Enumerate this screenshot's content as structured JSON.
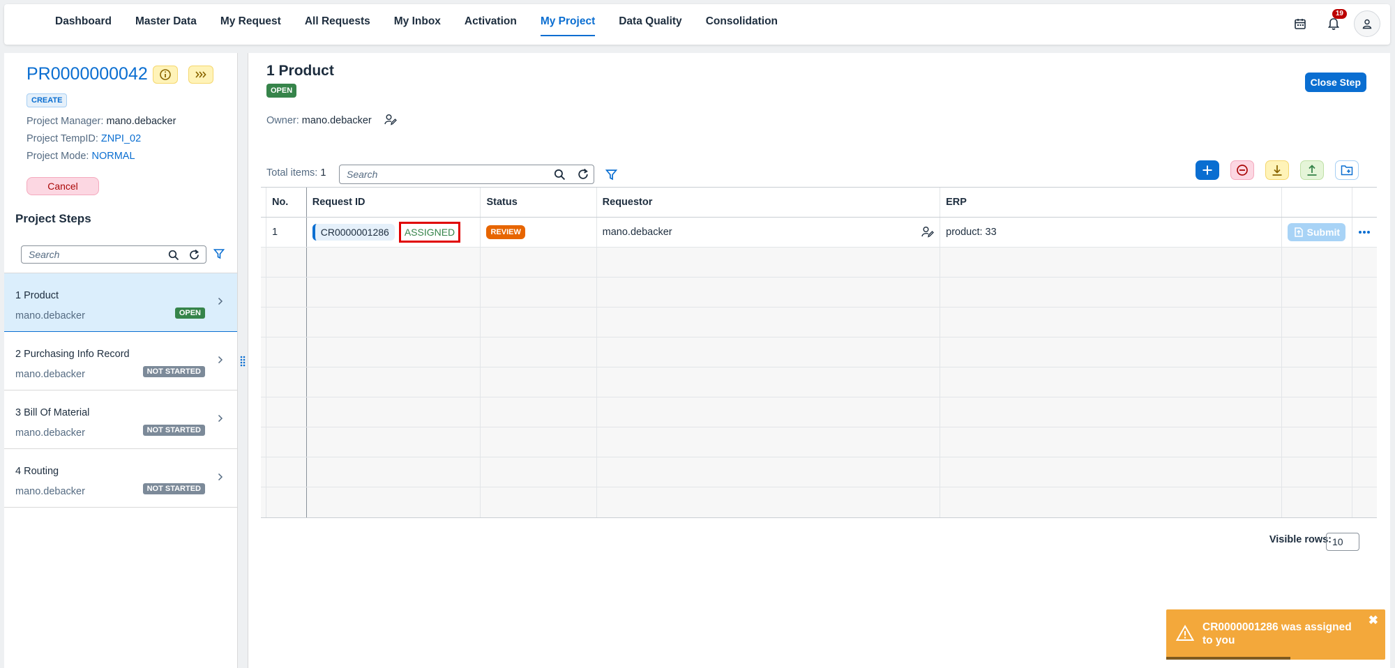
{
  "nav": {
    "items": [
      "Dashboard",
      "Master Data",
      "My Request",
      "All Requests",
      "My Inbox",
      "Activation",
      "My Project",
      "Data Quality",
      "Consolidation"
    ],
    "active": "My Project",
    "notification_count": "19",
    "icons": [
      "calendar-icon",
      "bell-icon",
      "user-icon"
    ]
  },
  "project": {
    "id": "PR0000000042",
    "type_tag": "CREATE",
    "manager_label": "Project Manager:",
    "manager": "mano.debacker",
    "temp_label": "Project TempID:",
    "temp_id": "ZNPI_02",
    "mode_label": "Project Mode:",
    "mode": "NORMAL",
    "cancel_label": "Cancel"
  },
  "steps": {
    "title": "Project Steps",
    "search_placeholder": "Search",
    "items": [
      {
        "name": "1 Product",
        "owner": "mano.debacker",
        "status": "OPEN"
      },
      {
        "name": "2 Purchasing Info Record",
        "owner": "mano.debacker",
        "status": "NOT STARTED"
      },
      {
        "name": "3 Bill Of Material",
        "owner": "mano.debacker",
        "status": "NOT STARTED"
      },
      {
        "name": "4 Routing",
        "owner": "mano.debacker",
        "status": "NOT STARTED"
      }
    ]
  },
  "main": {
    "title": "1 Product",
    "status": "OPEN",
    "owner_label": "Owner:",
    "owner": "mano.debacker",
    "close_step_label": "Close Step",
    "total_label": "Total items:",
    "total_count": "1",
    "search_placeholder": "Search"
  },
  "table": {
    "columns": [
      "No.",
      "Request ID",
      "Status",
      "Requestor",
      "ERP"
    ],
    "rows": [
      {
        "no": "1",
        "request_id": "CR0000001286",
        "assignment": "ASSIGNED",
        "status": "REVIEW",
        "requestor": "mano.debacker",
        "erp": "product: 33",
        "action": "Submit"
      }
    ],
    "visible_rows_label": "Visible rows:",
    "visible_rows_value": "10"
  },
  "toast": {
    "message": "CR0000001286 was assigned to you",
    "close": "✖"
  },
  "colors": {
    "accent": "#0a6ed1",
    "success": "#36844a",
    "warning": "#e76500",
    "toast": "#f3a83b"
  }
}
